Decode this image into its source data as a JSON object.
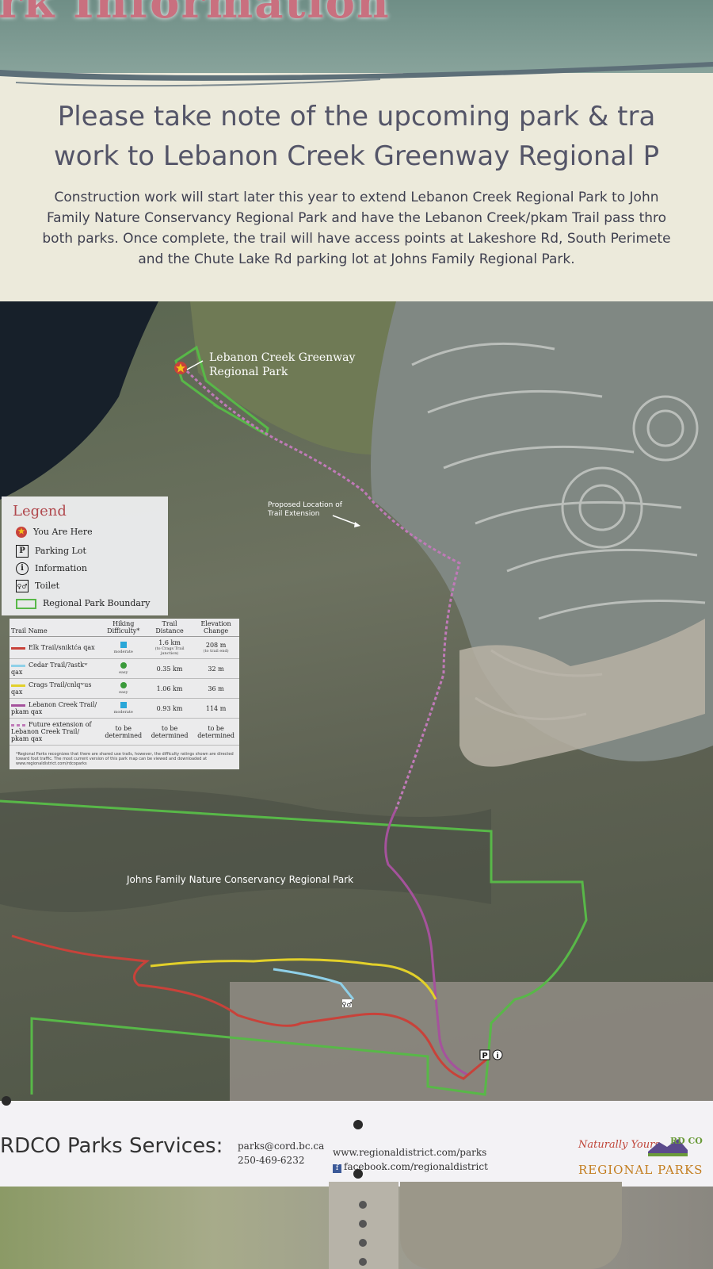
{
  "banner": {
    "title": "ark Information"
  },
  "notice": {
    "heading_line1": "Please take note of the upcoming park & tra",
    "heading_line2": "work to Lebanon Creek Greenway Regional P",
    "body_line1": "Construction work will start later this year to extend Lebanon Creek Regional Park to John",
    "body_line2": "Family Nature Conservancy Regional Park and have the Lebanon Creek/pkam Trail pass thro",
    "body_line3": "both parks. Once complete, the trail will have access points at Lakeshore Rd, South Perimete",
    "body_line4": "and the Chute Lake Rd parking lot at Johns Family Regional Park."
  },
  "map": {
    "label_lebanon_line1": "Lebanon Creek Greenway",
    "label_lebanon_line2": "Regional Park",
    "label_proposed_line1": "Proposed Location of",
    "label_proposed_line2": "Trail Extension",
    "label_johns": "Johns Family Nature Conservancy Regional Park",
    "colors": {
      "elk": "#c8423a",
      "cedar": "#8fd0e8",
      "crags": "#e2d02a",
      "lebanon": "#a5529c",
      "boundary": "#58b848"
    }
  },
  "legend": {
    "title": "Legend",
    "items": [
      {
        "icon": "star-icon",
        "label": "You Are Here"
      },
      {
        "icon": "parking-icon",
        "glyph": "P",
        "label": "Parking Lot"
      },
      {
        "icon": "info-icon",
        "glyph": "i",
        "label": "Information"
      },
      {
        "icon": "toilet-icon",
        "glyph": "♀♂",
        "label": "Toilet"
      },
      {
        "icon": "boundary-icon",
        "label": "Regional Park Boundary"
      }
    ]
  },
  "trail_table": {
    "headers": [
      "Trail Name",
      "Hiking Difficulty*",
      "Trail Distance",
      "Elevation Change"
    ],
    "rows": [
      {
        "name": "Elk Trail/sniktća qax",
        "difficulty": "moderate",
        "distance": "1.6 km",
        "distance_note": "(to Crags Trail junction)",
        "elevation": "208 m",
        "elevation_note": "(to trail end)",
        "color": "#c8423a",
        "dot": "#2aa7d8"
      },
      {
        "name": "Cedar Trail/?astkʷ qax",
        "difficulty": "easy",
        "distance": "0.35 km",
        "distance_note": "",
        "elevation": "32 m",
        "elevation_note": "",
        "color": "#8fd0e8",
        "dot": "#3a9a3a"
      },
      {
        "name": "Crags Trail/cnlqʷus qax",
        "difficulty": "easy",
        "distance": "1.06 km",
        "distance_note": "",
        "elevation": "36 m",
        "elevation_note": "",
        "color": "#e2d02a",
        "dot": "#3a9a3a"
      },
      {
        "name": "Lebanon Creek Trail/ pkam qax",
        "difficulty": "moderate",
        "distance": "0.93 km",
        "distance_note": "",
        "elevation": "114 m",
        "elevation_note": "",
        "color": "#a5529c",
        "dot": "#2aa7d8"
      },
      {
        "name": "Future extension of Lebanon Creek Trail/ pkam qax",
        "difficulty": "to be determined",
        "distance": "to be determined",
        "distance_note": "",
        "elevation": "to be determined",
        "elevation_note": "",
        "color": "#c07ab8",
        "dot": ""
      }
    ],
    "footnote": "*Regional Parks recognizes that there are shared use trails, however, the difficulty ratings shown are directed toward foot traffic. The most current version of this park map can be viewed and downloaded at www.regionaldistrict.com/rdcoparks"
  },
  "footer": {
    "name": "RDCO Parks Services:",
    "email": "parks@cord.bc.ca",
    "phone": "250-469-6232",
    "website": "www.regionaldistrict.com/parks",
    "facebook": "facebook.com/regionaldistrict",
    "tagline": "Naturally Yours",
    "brand": "REGIONAL PARKS",
    "logo_text": "RD CO"
  }
}
